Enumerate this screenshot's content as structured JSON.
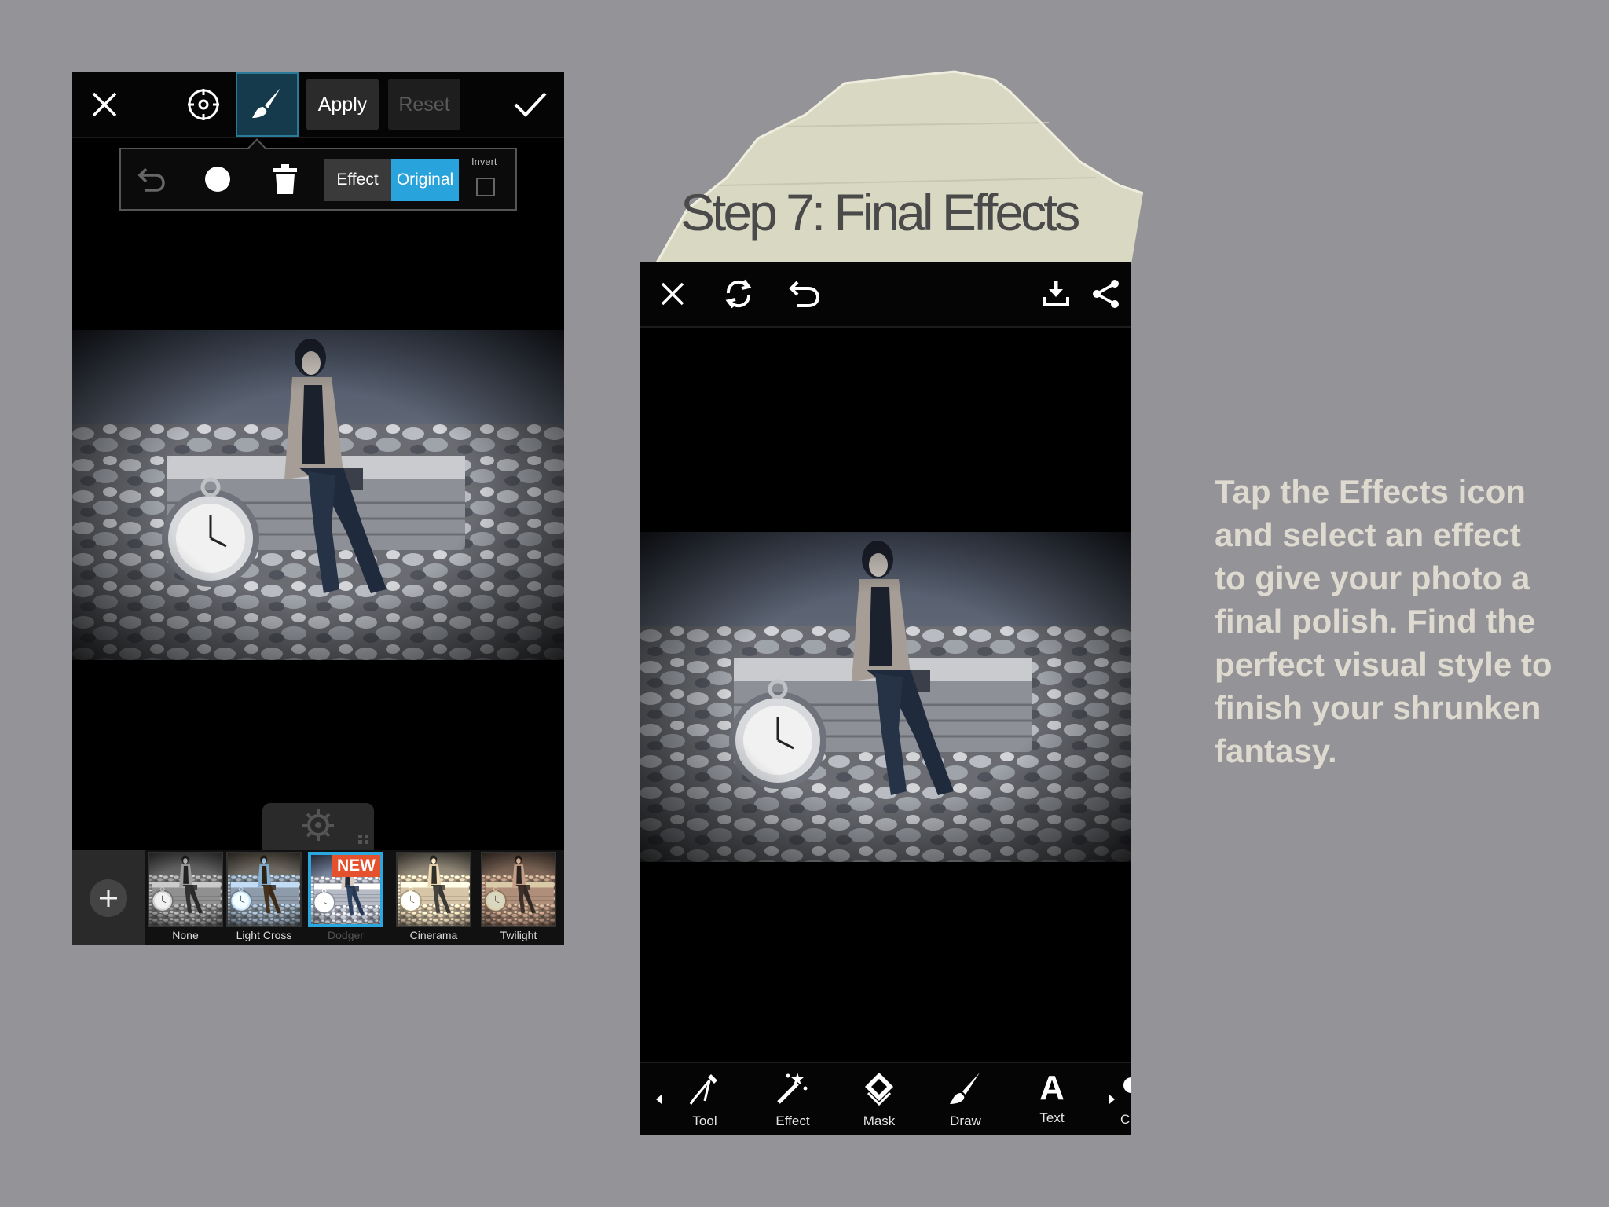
{
  "title": "Step 7: Final Effects",
  "description": "Tap the Effects icon and select an effect to give your photo a final polish. Find the perfect visual style to finish your shrunken fantasy.",
  "left_phone": {
    "top_toolbar": {
      "close_icon": "close-icon",
      "target_icon": "crosshair-icon",
      "brush_icon": "brush-icon",
      "apply_label": "Apply",
      "reset_label": "Reset",
      "confirm_icon": "check-icon"
    },
    "brush_panel": {
      "undo_icon": "undo-icon",
      "brush_size_icon": "brush-size-icon",
      "delete_icon": "trash-icon",
      "effect_label": "Effect",
      "original_label": "Original",
      "invert_label": "Invert",
      "invert_checked": false
    },
    "settings_icon": "gear-icon",
    "filters": [
      {
        "label": "None",
        "selected": false,
        "badge": ""
      },
      {
        "label": "Light Cross",
        "selected": false,
        "badge": ""
      },
      {
        "label": "Dodger",
        "selected": true,
        "badge": "NEW"
      },
      {
        "label": "Cinerama",
        "selected": false,
        "badge": ""
      },
      {
        "label": "Twilight",
        "selected": false,
        "badge": ""
      }
    ]
  },
  "right_phone": {
    "top_toolbar": {
      "close_icon": "close-icon",
      "rotate_icon": "refresh-icon",
      "undo_icon": "undo-icon",
      "download_icon": "download-icon",
      "share_icon": "share-icon"
    },
    "bottom_tools": [
      {
        "label": "Tool",
        "icon": "compass-tool-icon"
      },
      {
        "label": "Effect",
        "icon": "magic-wand-icon"
      },
      {
        "label": "Mask",
        "icon": "mask-icon"
      },
      {
        "label": "Draw",
        "icon": "brush-icon"
      },
      {
        "label": "Text",
        "icon": "text-icon"
      }
    ],
    "bottom_tools_partial": "C"
  },
  "colors": {
    "background": "#939398",
    "accent_blue": "#29a3db",
    "new_badge": "#e5502d",
    "description_text": "#dedad0"
  }
}
